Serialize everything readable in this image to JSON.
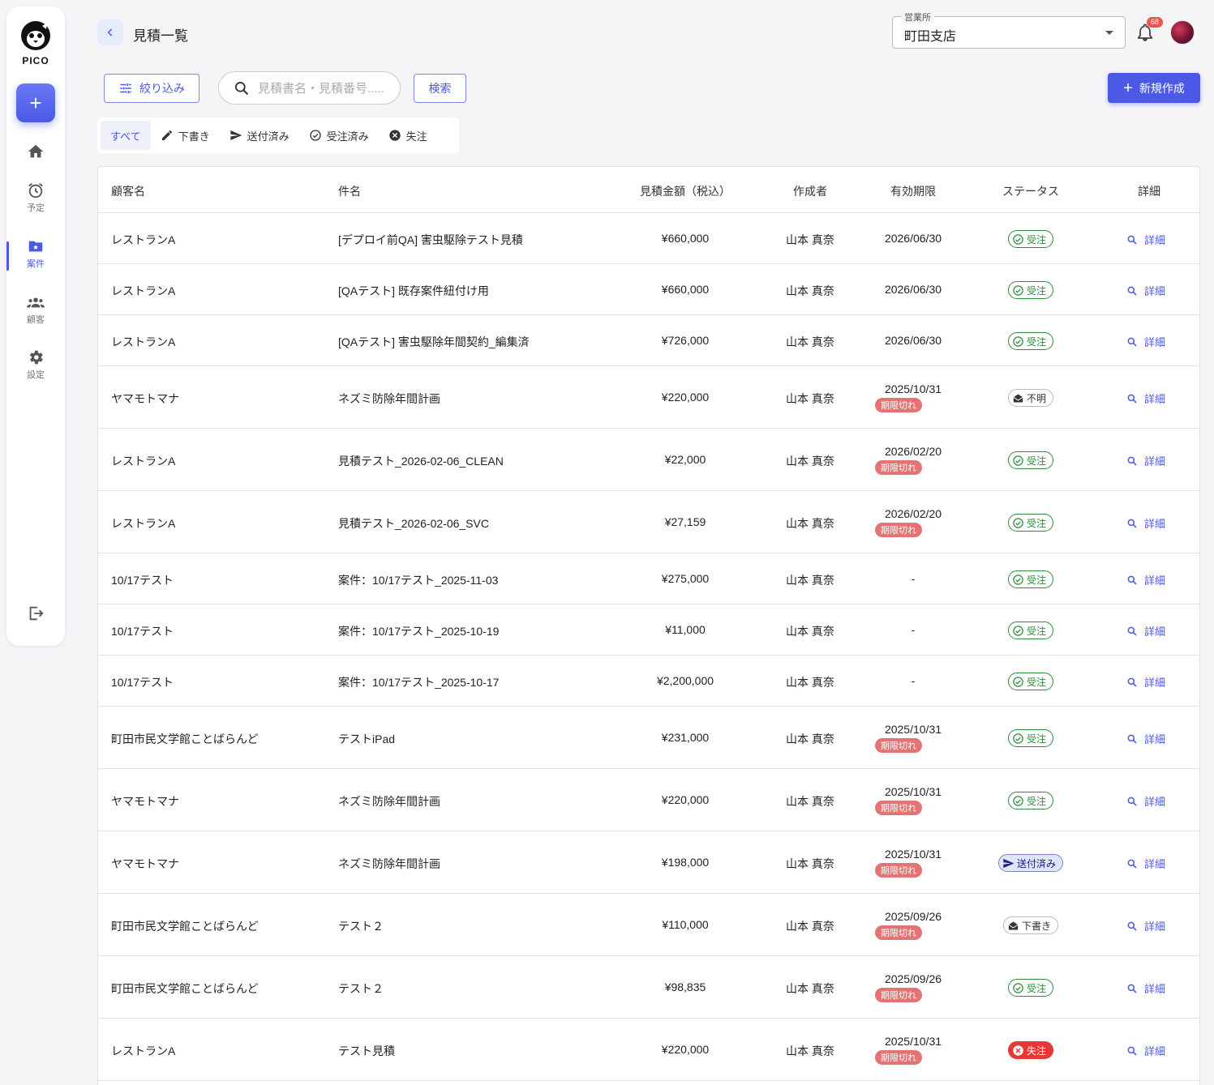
{
  "sidebar": {
    "logo_text": "PICO",
    "fab_label": "+",
    "items": [
      {
        "label": ""
      },
      {
        "label": "予定"
      },
      {
        "label": "案件"
      },
      {
        "label": "顧客"
      },
      {
        "label": "設定"
      }
    ]
  },
  "header": {
    "title": "見積一覧",
    "branch_label": "営業所",
    "branch_value": "町田支店",
    "notification_count": "68"
  },
  "toolbar": {
    "filter_label": "絞り込み",
    "search_placeholder": "見積書名・見積番号.....",
    "search_button": "検索",
    "new_button": "新規作成"
  },
  "tabs": [
    {
      "label": "すべて"
    },
    {
      "label": "下書き"
    },
    {
      "label": "送付済み"
    },
    {
      "label": "受注済み"
    },
    {
      "label": "失注"
    }
  ],
  "table": {
    "headers": [
      "顧客名",
      "件名",
      "見積金額（税込）",
      "作成者",
      "有効期限",
      "ステータス",
      "詳細"
    ],
    "expired_label": "期限切れ",
    "detail_label": "詳細",
    "rows": [
      {
        "customer": "レストランA",
        "subject": "[デプロイ前QA] 害虫駆除テスト見積",
        "amount": "¥660,000",
        "author": "山本 真奈",
        "expiry": "2026/06/30",
        "expired": false,
        "status": "受注",
        "status_type": "ordered"
      },
      {
        "customer": "レストランA",
        "subject": "[QAテスト] 既存案件紐付け用",
        "amount": "¥660,000",
        "author": "山本 真奈",
        "expiry": "2026/06/30",
        "expired": false,
        "status": "受注",
        "status_type": "ordered"
      },
      {
        "customer": "レストランA",
        "subject": "[QAテスト] 害虫駆除年間契約_編集済",
        "amount": "¥726,000",
        "author": "山本 真奈",
        "expiry": "2026/06/30",
        "expired": false,
        "status": "受注",
        "status_type": "ordered"
      },
      {
        "customer": "ヤマモトマナ",
        "subject": "ネズミ防除年間計画",
        "amount": "¥220,000",
        "author": "山本 真奈",
        "expiry": "2025/10/31",
        "expired": true,
        "status": "不明",
        "status_type": "unknown"
      },
      {
        "customer": "レストランA",
        "subject": "見積テスト_2026-02-06_CLEAN",
        "amount": "¥22,000",
        "author": "山本 真奈",
        "expiry": "2026/02/20",
        "expired": true,
        "status": "受注",
        "status_type": "ordered"
      },
      {
        "customer": "レストランA",
        "subject": "見積テスト_2026-02-06_SVC",
        "amount": "¥27,159",
        "author": "山本 真奈",
        "expiry": "2026/02/20",
        "expired": true,
        "status": "受注",
        "status_type": "ordered"
      },
      {
        "customer": "10/17テスト",
        "subject": "案件：10/17テスト_2025-11-03",
        "amount": "¥275,000",
        "author": "山本 真奈",
        "expiry": "-",
        "expired": false,
        "status": "受注",
        "status_type": "ordered"
      },
      {
        "customer": "10/17テスト",
        "subject": "案件：10/17テスト_2025-10-19",
        "amount": "¥11,000",
        "author": "山本 真奈",
        "expiry": "-",
        "expired": false,
        "status": "受注",
        "status_type": "ordered"
      },
      {
        "customer": "10/17テスト",
        "subject": "案件：10/17テスト_2025-10-17",
        "amount": "¥2,200,000",
        "author": "山本 真奈",
        "expiry": "-",
        "expired": false,
        "status": "受注",
        "status_type": "ordered"
      },
      {
        "customer": "町田市民文学館ことばらんど",
        "subject": "テストiPad",
        "amount": "¥231,000",
        "author": "山本 真奈",
        "expiry": "2025/10/31",
        "expired": true,
        "status": "受注",
        "status_type": "ordered"
      },
      {
        "customer": "ヤマモトマナ",
        "subject": "ネズミ防除年間計画",
        "amount": "¥220,000",
        "author": "山本 真奈",
        "expiry": "2025/10/31",
        "expired": true,
        "status": "受注",
        "status_type": "ordered"
      },
      {
        "customer": "ヤマモトマナ",
        "subject": "ネズミ防除年間計画",
        "amount": "¥198,000",
        "author": "山本 真奈",
        "expiry": "2025/10/31",
        "expired": true,
        "status": "送付済み",
        "status_type": "sent"
      },
      {
        "customer": "町田市民文学館ことばらんど",
        "subject": "テスト２",
        "amount": "¥110,000",
        "author": "山本 真奈",
        "expiry": "2025/09/26",
        "expired": true,
        "status": "下書き",
        "status_type": "draft"
      },
      {
        "customer": "町田市民文学館ことばらんど",
        "subject": "テスト２",
        "amount": "¥98,835",
        "author": "山本 真奈",
        "expiry": "2025/09/26",
        "expired": true,
        "status": "受注",
        "status_type": "ordered"
      },
      {
        "customer": "レストランA",
        "subject": "テスト見積",
        "amount": "¥220,000",
        "author": "山本 真奈",
        "expiry": "2025/10/31",
        "expired": true,
        "status": "失注",
        "status_type": "lost"
      }
    ]
  },
  "colors": {
    "primary": "#4b59e6",
    "ordered": "#2e8b3e",
    "expired": "#e57373",
    "lost": "#e53935",
    "sent_bg": "#dfe4fb"
  }
}
